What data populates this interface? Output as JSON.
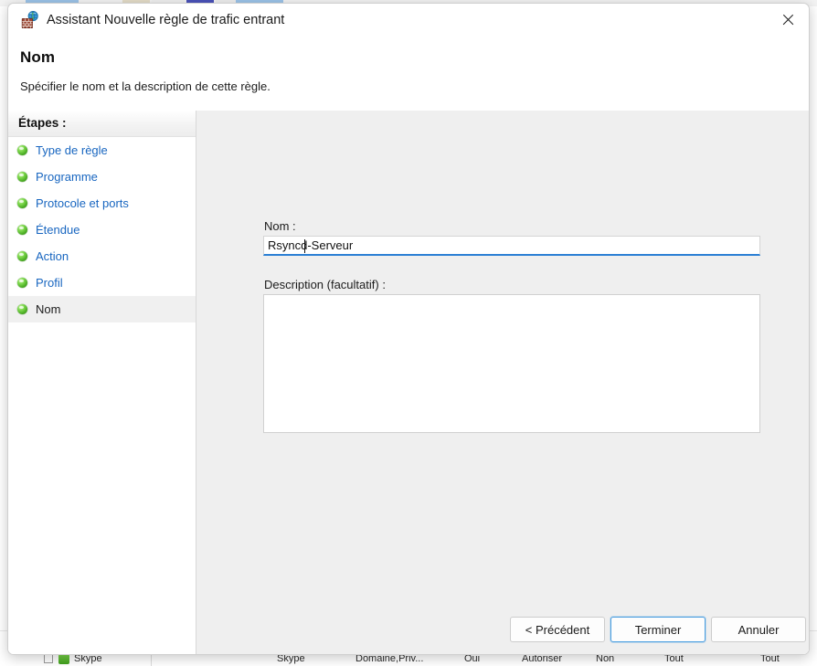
{
  "window": {
    "title": "Assistant Nouvelle règle de trafic entrant",
    "icon": "firewall-globe-icon",
    "close_label": "✕"
  },
  "header": {
    "heading": "Nom",
    "subheading": "Spécifier le nom et la description de cette règle."
  },
  "sidebar": {
    "header_label": "Étapes :",
    "items": [
      {
        "label": "Type de règle",
        "state": "completed"
      },
      {
        "label": "Programme",
        "state": "completed"
      },
      {
        "label": "Protocole et ports",
        "state": "completed"
      },
      {
        "label": "Étendue",
        "state": "completed"
      },
      {
        "label": "Action",
        "state": "completed"
      },
      {
        "label": "Profil",
        "state": "completed"
      },
      {
        "label": "Nom",
        "state": "current"
      }
    ]
  },
  "form": {
    "name_label": "Nom :",
    "name_value": "Rsyncd-Serveur",
    "name_placeholder": "",
    "description_label": "Description (facultatif) :",
    "description_value": "",
    "description_placeholder": ""
  },
  "buttons": {
    "previous": "< Précédent",
    "finish": "Terminer",
    "cancel": "Annuler"
  },
  "background": {
    "row": {
      "name": "Skype",
      "group": "Skype",
      "profile": "Domaine,Priv...",
      "enabled": "Oui",
      "action": "Autoriser",
      "override": "Non",
      "program": "Tout",
      "local_address": "Tout"
    }
  },
  "colors": {
    "accent": "#2a7fd4",
    "link": "#1866c0",
    "panel": "#efefef",
    "step_bullet": "#4cae25"
  }
}
